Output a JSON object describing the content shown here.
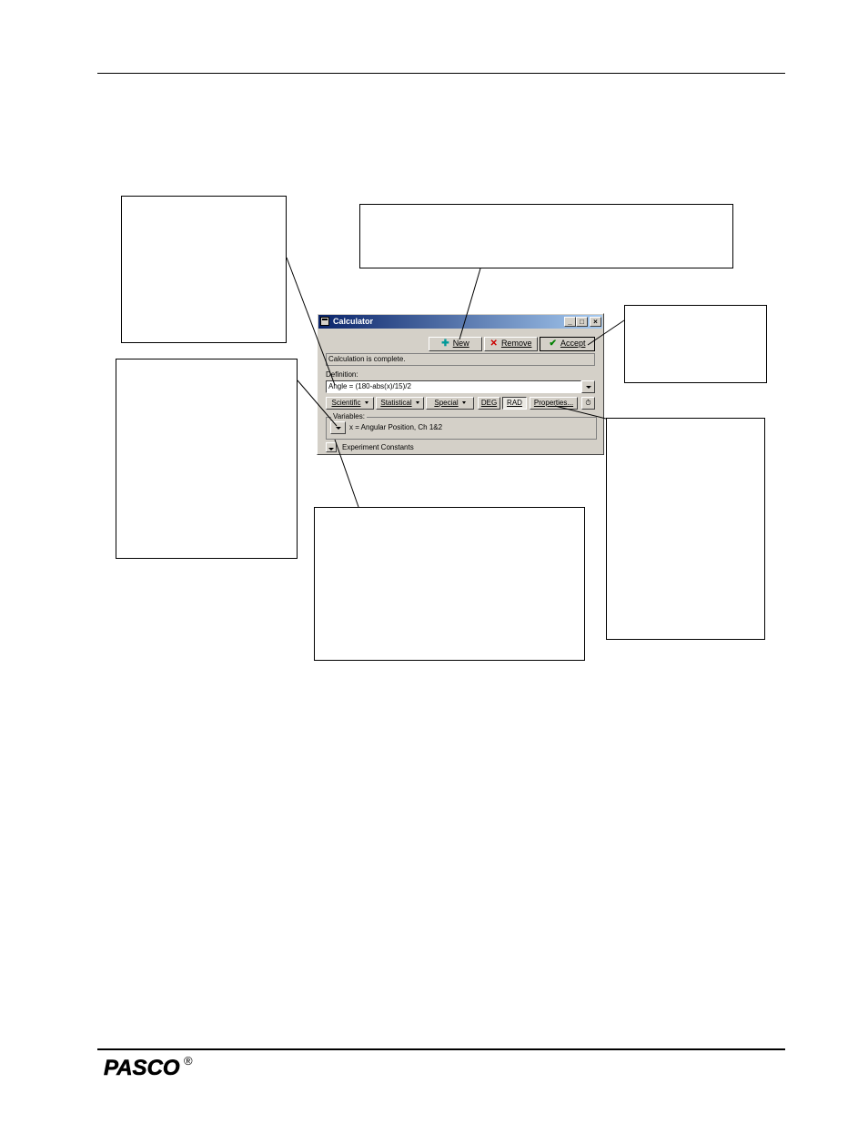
{
  "window": {
    "title": "Calculator",
    "controls": {
      "minimize": "_",
      "maximize": "□",
      "close": "×"
    }
  },
  "toolbar": {
    "new_label": "New",
    "remove_label": "Remove",
    "accept_label": "Accept",
    "new_icon": "plus-icon",
    "remove_icon": "x-icon",
    "accept_icon": "checkmark-icon"
  },
  "status": {
    "text": "Calculation is complete."
  },
  "definition": {
    "label": "Definition:",
    "value": "Angle = (180-abs(x)/15)/2"
  },
  "function_menus": {
    "scientific": "Scientific",
    "statistical": "Statistical",
    "special": "Special",
    "deg": "DEG",
    "rad": "RAD",
    "properties": "Properties...",
    "selected_unit": "RAD"
  },
  "variables": {
    "legend": "Variables:",
    "items": [
      "x = Angular Position, Ch 1&2"
    ]
  },
  "experiment_constants": {
    "label": "Experiment Constants"
  },
  "footer": {
    "brand": "PASCO",
    "registered": "®"
  }
}
